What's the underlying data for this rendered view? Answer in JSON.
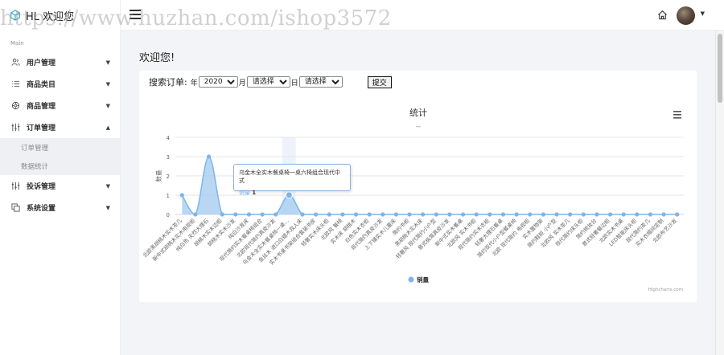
{
  "watermark": "https://www.huzhan.com/ishop3572",
  "header": {
    "brand": "HL 欢迎您"
  },
  "sidebar": {
    "section_label": "Main",
    "items": [
      {
        "label": "用户管理",
        "icon": "users-icon",
        "chevron": "⌄"
      },
      {
        "label": "商品类目",
        "icon": "list-icon",
        "chevron": "⌄"
      },
      {
        "label": "商品管理",
        "icon": "gear-icon",
        "chevron": "⌄"
      },
      {
        "label": "订单管理",
        "icon": "sliders-icon",
        "chevron": "⌃"
      },
      {
        "label": "投诉管理",
        "icon": "sliders-icon",
        "chevron": "⌄"
      },
      {
        "label": "系统设置",
        "icon": "copy-icon",
        "chevron": "⌄"
      }
    ],
    "subitems": [
      {
        "label": "订单管理"
      },
      {
        "label": "数据统计"
      }
    ]
  },
  "page": {
    "welcome": "欢迎您!"
  },
  "search": {
    "label": "搜索订单:",
    "year_label": "年",
    "year_value": "2020",
    "month_label": "月",
    "month_value": "请选择",
    "day_label": "日",
    "day_value": "请选择",
    "submit": "提交"
  },
  "tooltip": {
    "title": "乌金木全实木餐桌椅一桌六椅组合现代中式",
    "series": "销量",
    "value": "1"
  },
  "colors": {
    "series": "#7cb5ec",
    "series_fill": "#a8cdf0",
    "grid": "#e6e6e6",
    "hover_band": "#eef3fb"
  },
  "chart_data": {
    "type": "area",
    "title": "统计",
    "subtitle": "--",
    "xlabel": "",
    "ylabel": "数量",
    "ylim": [
      0,
      4
    ],
    "yticks": [
      0,
      1,
      2,
      3,
      4
    ],
    "grid": true,
    "legend": "bottom",
    "credits": "Highcharts.com",
    "categories": [
      "北欧黑胡桃木实木茶几",
      "新中式胡桃木实木电视柜",
      "纯白色 天然大理石",
      "胡桃木实木边柜",
      "胡桃木实木沙发",
      "纯白沙发床",
      "现代简约实木餐桌椅组合",
      "北欧现代简约真皮沙发",
      "乌金木全实木餐桌椅一桌...",
      "金丝木 进口白蜡木双人床",
      "实木书桌书架组合套装书房",
      "轻奢实木床头柜",
      "北欧风 餐椅",
      "实木床 胡桃木",
      "白色实木衣柜",
      "现代简约真皮沙发",
      "上下铺实木儿童床",
      "简约书柜",
      "黑胡桃木实木床",
      "轻奢风 现代简约小户型",
      "意式极简真皮沙发",
      "新中式实木餐桌",
      "北欧风 实木书柜",
      "现代简约实木衣柜",
      "轻奢大理石餐桌",
      "简约现代小户型餐桌椅",
      "北欧 现代简约 电视柜",
      "实木置物架",
      "简约鞋柜 小户型",
      "北欧风 实木茶几",
      "现代简约床头柜",
      "简约梳妆台",
      "意式轻奢餐边柜",
      "北欧实木书桌",
      "LED智能床头柜",
      "现代简约茶几",
      "实木衣帽间定制",
      "北欧布艺沙发"
    ],
    "series": [
      {
        "name": "销量",
        "values": [
          1,
          0,
          3,
          0,
          0,
          0,
          0,
          0,
          1,
          0,
          0,
          0,
          0,
          0,
          0,
          0,
          0,
          0,
          0,
          0,
          0,
          0,
          0,
          0,
          0,
          0,
          0,
          0,
          0,
          0,
          0,
          0,
          0,
          0,
          0,
          0,
          0,
          0
        ]
      }
    ],
    "hovered_index": 8
  }
}
